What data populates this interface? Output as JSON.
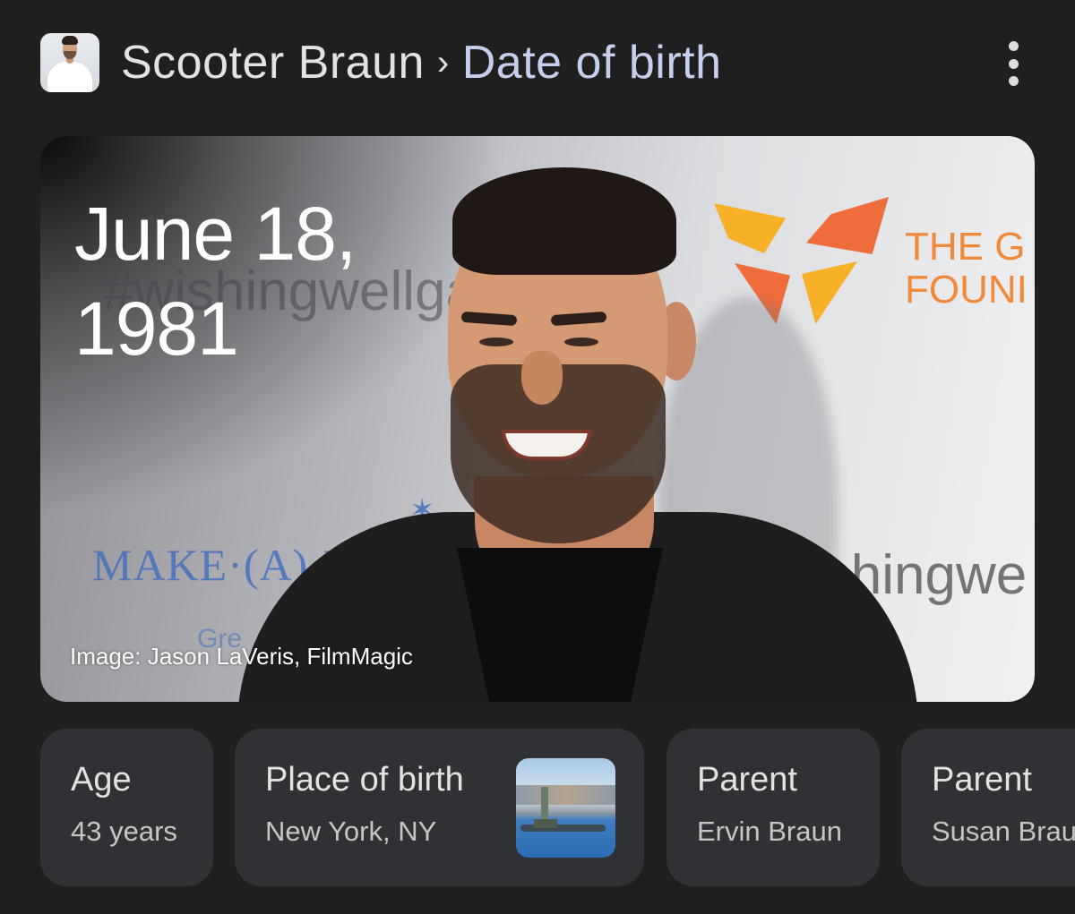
{
  "header": {
    "entity": "Scooter Braun",
    "separator": "›",
    "attribute": "Date of birth",
    "menu_icon": "more-vert-icon"
  },
  "hero": {
    "date_line1": "June 18,",
    "date_line2": "1981",
    "credit": "Image: Jason LaVeris, FilmMagic",
    "background_text": {
      "top": "#wishingwellgal",
      "right": "ishingwe",
      "make": "MAKE·(A)·W",
      "greet": "Gre",
      "logo_line1": "THE G",
      "logo_line2": "FOUNI"
    }
  },
  "chips": [
    {
      "label": "Age",
      "value": "43 years"
    },
    {
      "label": "Place of birth",
      "value": "New York, NY",
      "thumbnail": "statue-of-liberty-skyline"
    },
    {
      "label": "Parent",
      "value": "Ervin Braun"
    },
    {
      "label": "Parent",
      "value": "Susan Braun"
    }
  ],
  "colors": {
    "background": "#1f1f1f",
    "chip": "#303134",
    "attribute_text": "#c6d0ee"
  }
}
